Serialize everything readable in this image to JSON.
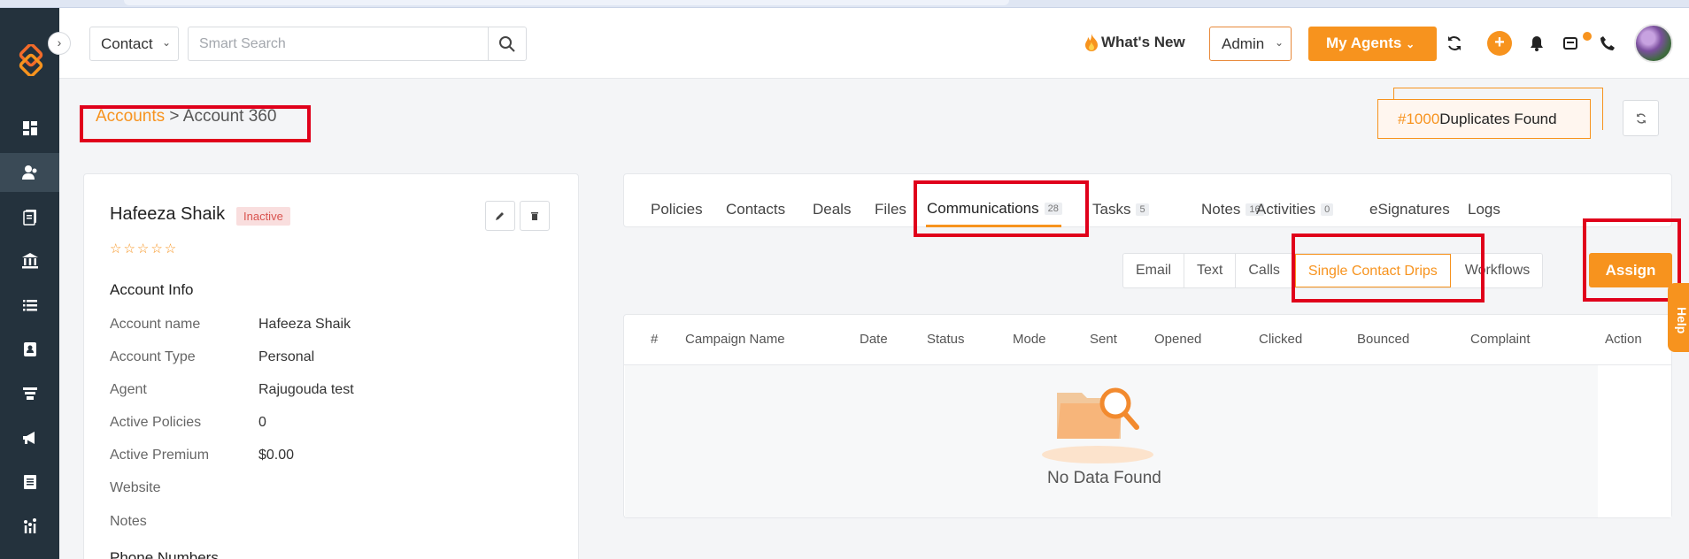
{
  "topbar": {
    "contact_select": "Contact",
    "search_placeholder": "Smart Search",
    "whats_new": "What's New",
    "admin_select": "Admin",
    "my_agents": "My Agents"
  },
  "breadcrumb": {
    "link": "Accounts",
    "separator": " > ",
    "current": "Account 360"
  },
  "duplicates": {
    "number": "#1000",
    "label": "Duplicates Found"
  },
  "account": {
    "name": "Hafeeza Shaik",
    "status": "Inactive",
    "rating_stars": "☆☆☆☆☆",
    "section_title": "Account Info",
    "fields": [
      {
        "label": "Account name",
        "value": "Hafeeza Shaik"
      },
      {
        "label": "Account Type",
        "value": "Personal"
      },
      {
        "label": "Agent",
        "value": "Rajugouda test"
      },
      {
        "label": "Active Policies",
        "value": "0"
      },
      {
        "label": "Active Premium",
        "value": "$0.00"
      },
      {
        "label": "Website",
        "value": ""
      },
      {
        "label": "Notes",
        "value": ""
      }
    ],
    "phone_title": "Phone Numbers"
  },
  "tabs": [
    {
      "label": "Policies",
      "count": ""
    },
    {
      "label": "Contacts",
      "count": ""
    },
    {
      "label": "Deals",
      "count": ""
    },
    {
      "label": "Files",
      "count": ""
    },
    {
      "label": "Communications",
      "count": "28"
    },
    {
      "label": "Tasks",
      "count": "5"
    },
    {
      "label": "Notes",
      "count": "16"
    },
    {
      "label": "Activities",
      "count": "0"
    },
    {
      "label": "eSignatures",
      "count": ""
    },
    {
      "label": "Logs",
      "count": ""
    }
  ],
  "active_tab": "Communications",
  "subtabs": [
    "Email",
    "Text",
    "Calls",
    "Single Contact Drips",
    "Workflows"
  ],
  "active_subtab": "Single Contact Drips",
  "assign_label": "Assign",
  "table": {
    "headers": [
      "#",
      "Campaign Name",
      "Date",
      "Status",
      "Mode",
      "Sent",
      "Opened",
      "Clicked",
      "Bounced",
      "Complaint",
      "Action"
    ],
    "empty_text": "No Data Found"
  },
  "help_label": "Help",
  "colors": {
    "accent": "#f7931e",
    "sidebar": "#24323d",
    "highlight": "#e0001b"
  }
}
